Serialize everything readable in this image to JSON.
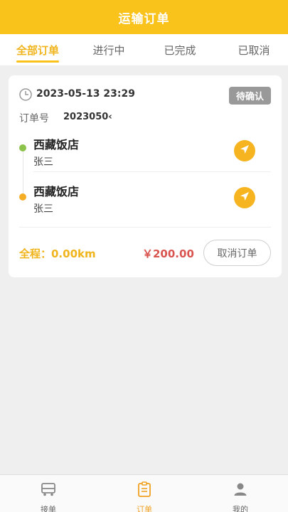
{
  "header": {
    "title": "运输订单"
  },
  "tabs": [
    {
      "label": "全部订单",
      "active": true
    },
    {
      "label": "进行中",
      "active": false
    },
    {
      "label": "已完成",
      "active": false
    },
    {
      "label": "已取消",
      "active": false
    }
  ],
  "order": {
    "datetime": "2023-05-13 23:29",
    "status": "待确认",
    "order_no_label": "订单号",
    "order_no": "2023050‹",
    "stops": [
      {
        "name": "西藏饭店",
        "contact": "张三",
        "dot_color": "#8dc34b",
        "icon": "navigate-icon"
      },
      {
        "name": "西藏饭店",
        "contact": "张三",
        "dot_color": "#f5ad26",
        "icon": "navigate-icon"
      }
    ],
    "distance": "全程：0.00km",
    "price": "￥200.00",
    "cancel_label": "取消订单"
  },
  "bottom_nav": [
    {
      "label": "接单",
      "icon": "truck-icon",
      "active": false
    },
    {
      "label": "订单",
      "icon": "order-list-icon",
      "active": true
    },
    {
      "label": "我的",
      "icon": "user-icon",
      "active": false
    }
  ],
  "colors": {
    "accent": "#f9c31b",
    "tab_active": "#f0b41c",
    "price": "#d9534f",
    "status_badge": "#999999",
    "background": "#efefef"
  }
}
